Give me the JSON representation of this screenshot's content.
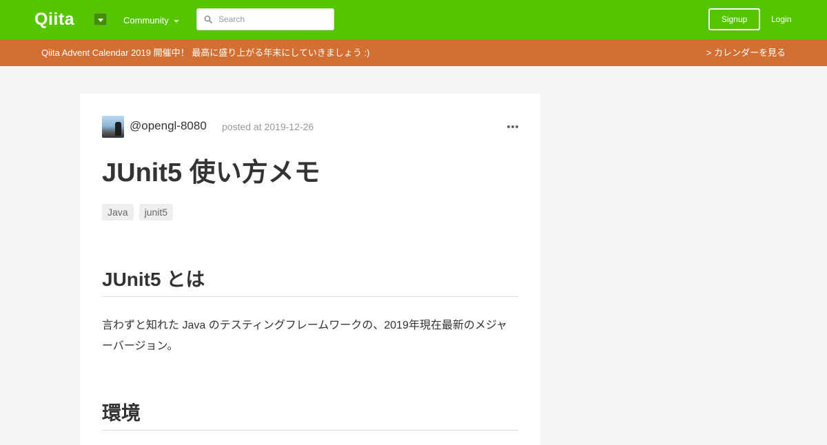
{
  "header": {
    "logo": "Qiita",
    "community_label": "Community",
    "search_placeholder": "Search",
    "signup_label": "Signup",
    "login_label": "Login",
    "brand_color": "#55c500"
  },
  "banner": {
    "text": "Qiita Advent Calendar 2019 開催中！ 最高に盛り上がる年末にしていきましょう :)",
    "link_label": "> カレンダーを見る",
    "color": "#d17032"
  },
  "article": {
    "author": "@opengl-8080",
    "posted": "posted at 2019-12-26",
    "title": "JUnit5 使い方メモ",
    "tags": [
      "Java",
      "junit5"
    ],
    "sections": [
      {
        "heading": "JUnit5 とは",
        "body": "言わずと知れた Java のテスティングフレームワークの、2019年現在最新のメジャーバージョン。"
      },
      {
        "heading": "環境"
      }
    ]
  }
}
